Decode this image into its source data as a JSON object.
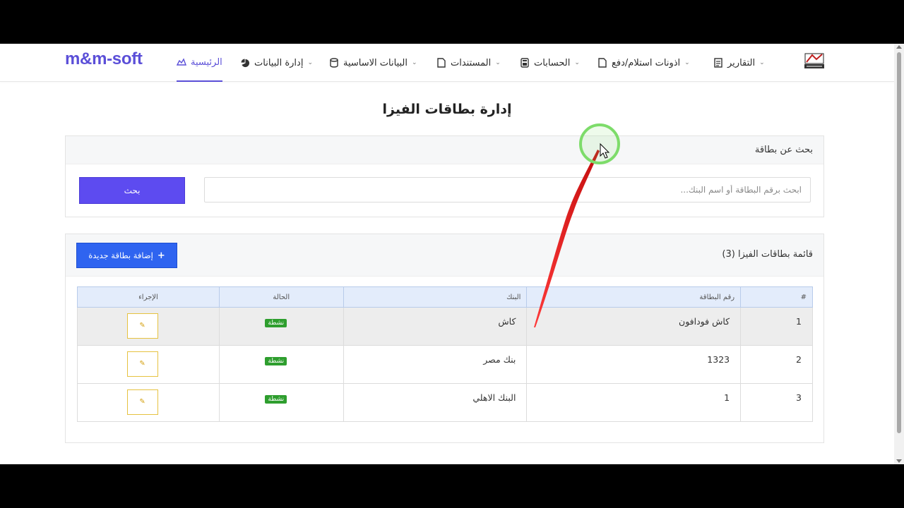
{
  "brand": "m&m-soft",
  "nav": {
    "home": "الرئيسية",
    "data_management": "إدارة البيانات",
    "master_data": "البيانات الاساسية",
    "documents": "المستندات",
    "accounts": "الحسابات",
    "vouchers": "اذونات استلام/دفع",
    "reports": "التقارير"
  },
  "page_title": "إدارة بطاقات الفيزا",
  "search": {
    "heading": "بحث عن بطاقة",
    "placeholder": "ابحث برقم البطاقة أو اسم البنك...",
    "button": "بحث"
  },
  "list": {
    "title": "قائمة بطاقات الفيزا (3)",
    "add_button": "إضافة بطاقة جديدة",
    "add_icon": "+",
    "columns": [
      "#",
      "رقم البطاقة",
      "البنك",
      "الحالة",
      "الإجراء"
    ],
    "rows": [
      {
        "index": "1",
        "card_number": "كاش فودافون",
        "bank": "كاش",
        "status": "نشطة"
      },
      {
        "index": "2",
        "card_number": "1323",
        "bank": "بنك مصر",
        "status": "نشطة"
      },
      {
        "index": "3",
        "card_number": "1",
        "bank": "البنك الاهلي",
        "status": "نشطة"
      }
    ]
  },
  "colors": {
    "brand": "#5b4fd8",
    "search_button": "#5d4bf0",
    "add_button": "#2f64f0",
    "status_active": "#2e9e2e",
    "edit_border": "#e6c240",
    "table_header": "#e3ecfb"
  },
  "icons": {
    "home": "home-icon",
    "data_management": "pie-chart-icon",
    "master_data": "database-icon",
    "documents": "file-icon",
    "accounts": "calculator-icon",
    "vouchers": "file-icon",
    "reports": "report-icon",
    "edit": "edit-icon"
  }
}
